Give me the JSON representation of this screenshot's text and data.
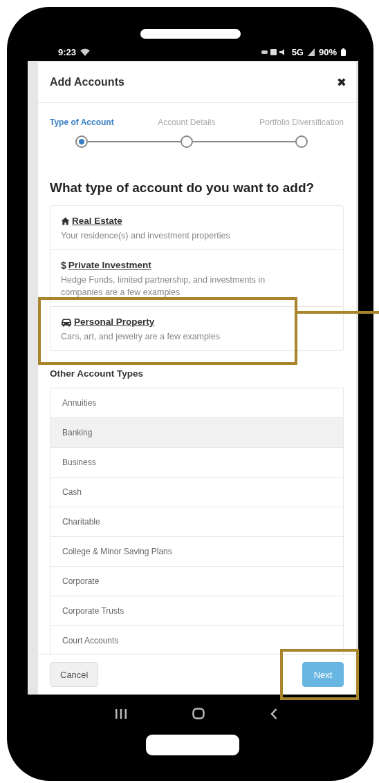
{
  "status_bar": {
    "time": "9:23",
    "network": "5G",
    "battery": "90%"
  },
  "dialog": {
    "title": "Add Accounts",
    "close": "✖"
  },
  "steps": [
    {
      "label": "Type of Account",
      "selected": true
    },
    {
      "label": "Account Details",
      "selected": false
    },
    {
      "label": "Portfolio Diversification",
      "selected": false
    }
  ],
  "question": "What type of account do you want to add?",
  "featured_types": [
    {
      "title": "Real Estate",
      "description": "Your residence(s) and investment properties"
    },
    {
      "symbol": "$",
      "title": "Private Investment",
      "description": "Hedge Funds, limited partnership, and investments in companies are a few examples"
    },
    {
      "title": "Personal Property",
      "description": "Cars, art, and jewelry are a few examples"
    }
  ],
  "other_heading": "Other Account Types",
  "other_types": [
    {
      "label": "Annuities",
      "selected": false
    },
    {
      "label": "Banking",
      "selected": true
    },
    {
      "label": "Business",
      "selected": false
    },
    {
      "label": "Cash",
      "selected": false
    },
    {
      "label": "Charitable",
      "selected": false
    },
    {
      "label": "College & Minor Saving Plans",
      "selected": false
    },
    {
      "label": "Corporate",
      "selected": false
    },
    {
      "label": "Corporate Trusts",
      "selected": false
    },
    {
      "label": "Court Accounts",
      "selected": false
    }
  ],
  "buttons": {
    "cancel": "Cancel",
    "next": "Next"
  }
}
